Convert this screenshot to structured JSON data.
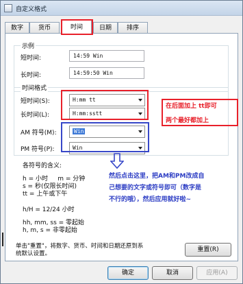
{
  "window": {
    "title": "自定义格式"
  },
  "tabs": [
    {
      "label": "数字"
    },
    {
      "label": "货币"
    },
    {
      "label": "时间"
    },
    {
      "label": "日期"
    },
    {
      "label": "排序"
    }
  ],
  "example": {
    "legend": "示例",
    "short_label": "短时间:",
    "short_value": "14:59  Win",
    "long_label": "长时间:",
    "long_value": "14:59:50 Win"
  },
  "time_format": {
    "legend": "时间格式",
    "short_label": "短时间(S):",
    "short_value": "H:mm tt",
    "long_label": "长时间(L):",
    "long_value": "H:mm:sstt",
    "am_label": "AM 符号(M):",
    "am_value": "Win",
    "pm_label": "PM 符号(P):",
    "pm_value": "Win"
  },
  "notations": {
    "title": "各符号的含义:",
    "line1": "h = 小时     m = 分钟",
    "line2": "s = 秒(仅限长时间)",
    "line3": "tt = 上午或下午",
    "line4": "h/H = 12/24 小时",
    "line5": "hh, mm, ss = 零起始",
    "line6": "h, m, s = 非零起始"
  },
  "reset": {
    "text_line1": "单击\"重置\"，将数字、货币、时间和日期还原到系",
    "text_line2": "统默认设置。",
    "button": "重置(R)"
  },
  "annotations": {
    "red_line1": "在后面加上 tt即可",
    "red_line2": "两个最好都加上",
    "blue_line1": "然后点击这里，把AM和PM改成自",
    "blue_line2": "己想要的文字或符号即可（数字是",
    "blue_line3": "不行的哦），然后应用就好啦~"
  },
  "buttons": {
    "ok": "确定",
    "cancel": "取消",
    "apply": "应用(A)"
  },
  "colors": {
    "annotation_red": "#e8202a",
    "annotation_blue": "#3747c8",
    "selection": "#3d79d6"
  }
}
